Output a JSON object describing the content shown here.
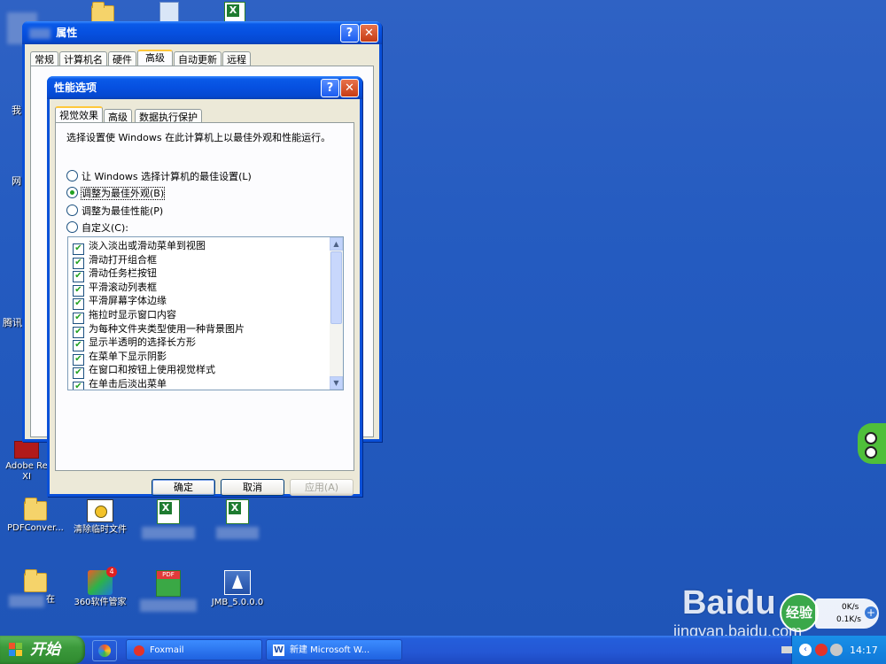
{
  "desktop_icons": [
    {
      "id": "adobe",
      "label": "Adobe Re\nXI"
    },
    {
      "id": "pdfconv",
      "label": "PDFConver..."
    },
    {
      "id": "cleantemp",
      "label": "清除临时文件"
    },
    {
      "id": "blur-xls1",
      "label": ""
    },
    {
      "id": "blur-xls2",
      "label": ""
    },
    {
      "id": "folder2",
      "label": "在"
    },
    {
      "id": "360",
      "label": "360软件管家"
    },
    {
      "id": "pdfdoc",
      "label": ""
    },
    {
      "id": "jmb",
      "label": "JMB_5.0.0.0"
    }
  ],
  "edge_labels": [
    "我",
    "网",
    "腾讯"
  ],
  "sysprops": {
    "title": "属性",
    "tabs": [
      "常规",
      "计算机名",
      "硬件",
      "高级",
      "自动更新",
      "远程"
    ],
    "active_tab": 3
  },
  "perf": {
    "title": "性能选项",
    "tabs": [
      "视觉效果",
      "高级",
      "数据执行保护"
    ],
    "active_tab": 0,
    "intro": "选择设置使 Windows 在此计算机上以最佳外观和性能运行。",
    "options": [
      {
        "label": "让 Windows 选择计算机的最佳设置(L)",
        "selected": false
      },
      {
        "label": "调整为最佳外观(B)",
        "selected": true
      },
      {
        "label": "调整为最佳性能(P)",
        "selected": false
      },
      {
        "label": "自定义(C):",
        "selected": false
      }
    ],
    "effects": [
      {
        "label": "淡入淡出或滑动菜单到视图",
        "checked": true
      },
      {
        "label": "滑动打开组合框",
        "checked": true
      },
      {
        "label": "滑动任务栏按钮",
        "checked": true
      },
      {
        "label": "平滑滚动列表框",
        "checked": true
      },
      {
        "label": "平滑屏幕字体边缘",
        "checked": true
      },
      {
        "label": "拖拉时显示窗口内容",
        "checked": true
      },
      {
        "label": "为每种文件夹类型使用一种背景图片",
        "checked": true
      },
      {
        "label": "显示半透明的选择长方形",
        "checked": true
      },
      {
        "label": "在菜单下显示阴影",
        "checked": true
      },
      {
        "label": "在窗口和按钮上使用视觉样式",
        "checked": true
      },
      {
        "label": "在单击后淡出菜单",
        "checked": true
      }
    ],
    "buttons": {
      "ok": "确定",
      "cancel": "取消",
      "apply": "应用(A)"
    }
  },
  "taskbar": {
    "start": "开始",
    "tasks": [
      "Foxmail",
      "新建 Microsoft W..."
    ],
    "net_up": "0K/s",
    "net_down": "0.1K/s",
    "clock": "14:17"
  },
  "watermark": {
    "brand": "Bai",
    "brand2": "du",
    "sub": "经验",
    "url": "jingyan.baidu.com"
  }
}
